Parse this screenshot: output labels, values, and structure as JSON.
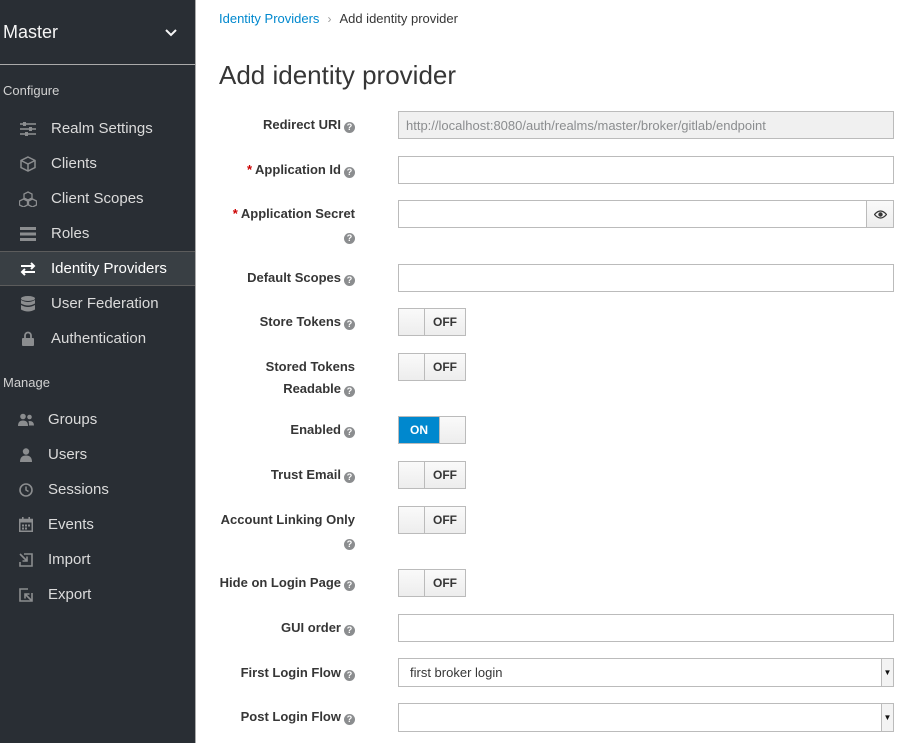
{
  "sidebar": {
    "realm": "Master",
    "configure_title": "Configure",
    "configure_items": [
      {
        "label": "Realm Settings",
        "icon": "sliders-icon"
      },
      {
        "label": "Clients",
        "icon": "cube-icon"
      },
      {
        "label": "Client Scopes",
        "icon": "cubes-icon"
      },
      {
        "label": "Roles",
        "icon": "list-icon"
      },
      {
        "label": "Identity Providers",
        "icon": "exchange-icon"
      },
      {
        "label": "User Federation",
        "icon": "database-icon"
      },
      {
        "label": "Authentication",
        "icon": "lock-icon"
      }
    ],
    "manage_title": "Manage",
    "manage_items": [
      {
        "label": "Groups",
        "icon": "users-icon"
      },
      {
        "label": "Users",
        "icon": "user-icon"
      },
      {
        "label": "Sessions",
        "icon": "clock-icon"
      },
      {
        "label": "Events",
        "icon": "calendar-icon"
      },
      {
        "label": "Import",
        "icon": "import-icon"
      },
      {
        "label": "Export",
        "icon": "export-icon"
      }
    ],
    "active_item": "Identity Providers"
  },
  "breadcrumb": {
    "parent": "Identity Providers",
    "current": "Add identity provider"
  },
  "page_title": "Add identity provider",
  "form": {
    "redirect_uri": {
      "label": "Redirect URI",
      "value": "http://localhost:8080/auth/realms/master/broker/gitlab/endpoint"
    },
    "application_id": {
      "label": "Application Id",
      "value": "",
      "required": true
    },
    "application_secret": {
      "label": "Application Secret",
      "value": "",
      "required": true
    },
    "default_scopes": {
      "label": "Default Scopes",
      "value": ""
    },
    "store_tokens": {
      "label": "Store Tokens",
      "state": "OFF"
    },
    "stored_tokens_readable": {
      "label_line1": "Stored Tokens",
      "label_line2": "Readable",
      "state": "OFF"
    },
    "enabled": {
      "label": "Enabled",
      "state": "ON"
    },
    "trust_email": {
      "label": "Trust Email",
      "state": "OFF"
    },
    "account_linking_only": {
      "label": "Account Linking Only",
      "state": "OFF"
    },
    "hide_on_login_page": {
      "label": "Hide on Login Page",
      "state": "OFF"
    },
    "gui_order": {
      "label": "GUI order",
      "value": ""
    },
    "first_login_flow": {
      "label": "First Login Flow",
      "value": "first broker login"
    },
    "post_login_flow": {
      "label": "Post Login Flow",
      "value": ""
    }
  },
  "help_glyph": "?",
  "required_mark": "*",
  "colors": {
    "sidebar_bg": "#292e34",
    "accent": "#0088ce",
    "required": "#cc0000"
  }
}
